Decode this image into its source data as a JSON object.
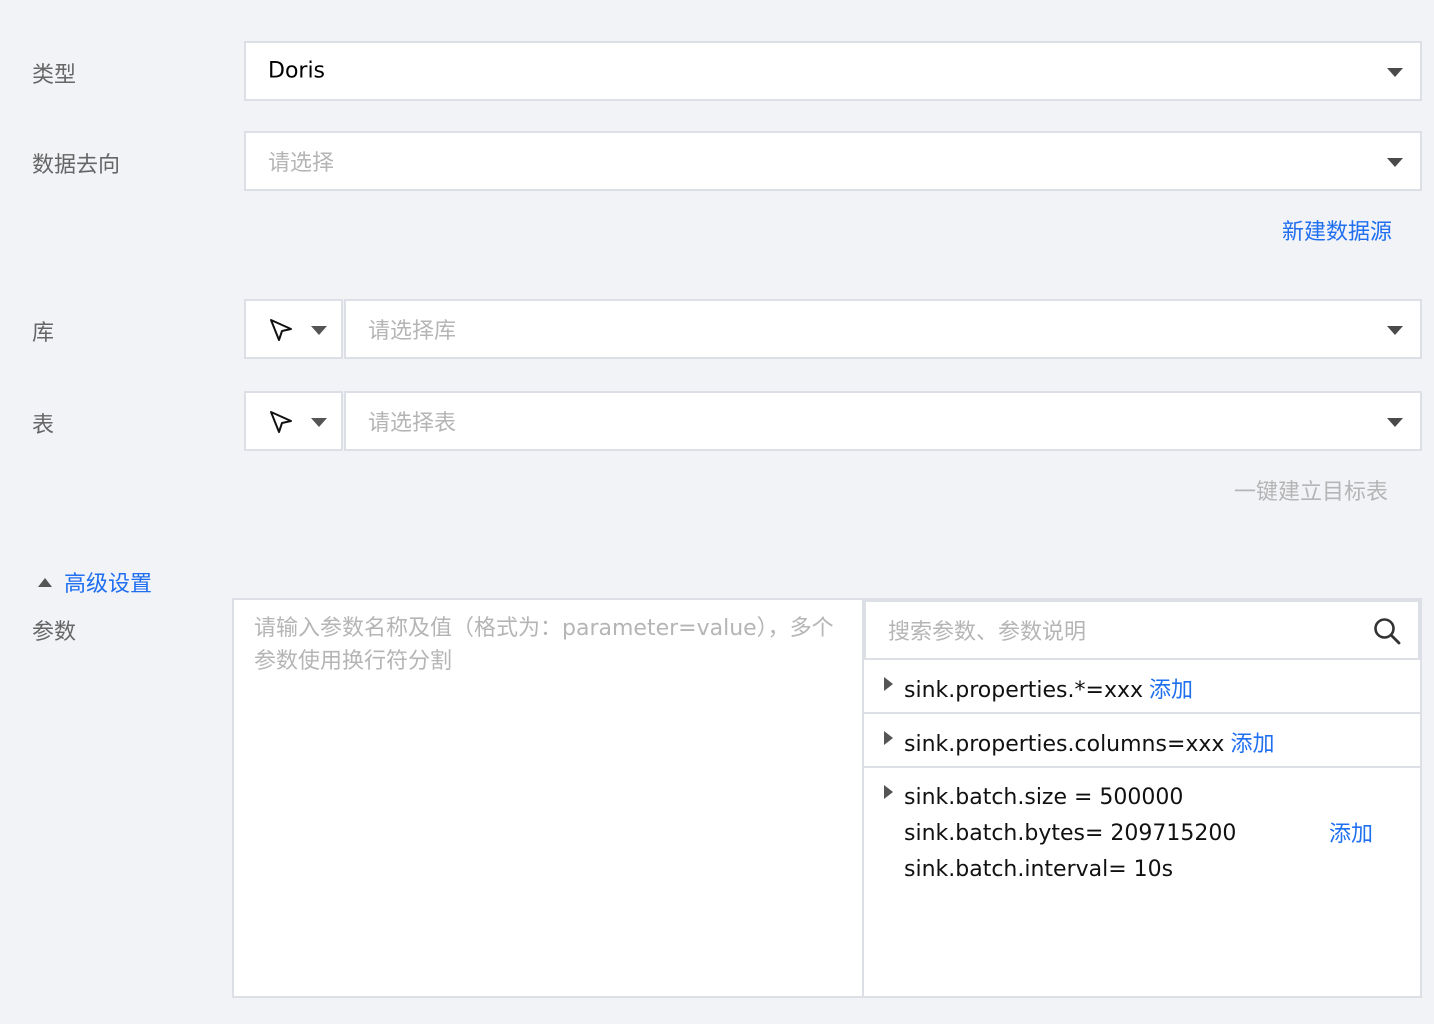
{
  "form": {
    "type": {
      "label": "类型",
      "value": "Doris"
    },
    "destination": {
      "label": "数据去向",
      "placeholder": "请选择"
    },
    "new_datasource_link": "新建数据源",
    "database": {
      "label": "库",
      "placeholder": "请选择库"
    },
    "table": {
      "label": "表",
      "placeholder": "请选择表"
    },
    "create_target_table_link": "一键建立目标表"
  },
  "advanced": {
    "toggle_label": "高级设置",
    "params_label": "参数",
    "textarea_placeholder": "请输入参数名称及值（格式为：parameter=value），多个参数使用换行符分割",
    "search_placeholder": "搜索参数、参数说明",
    "params": [
      {
        "text": "sink.properties.*=xxx",
        "add": "添加"
      },
      {
        "text": "sink.properties.columns=xxx",
        "add": "添加"
      },
      {
        "lines": [
          "sink.batch.size = 500000",
          "sink.batch.bytes= 209715200",
          "sink.batch.interval= 10s"
        ],
        "add": "添加"
      }
    ]
  },
  "icons": {
    "select_mode": "cursor-pointer-icon",
    "dropdown": "caret-down-icon",
    "search": "search-icon",
    "expand": "caret-right-icon",
    "collapse": "caret-up-icon"
  },
  "colors": {
    "background": "#f2f3f7",
    "accent": "#1f6ff0",
    "border": "#dcdfe6",
    "placeholder": "#b5b5b5"
  }
}
